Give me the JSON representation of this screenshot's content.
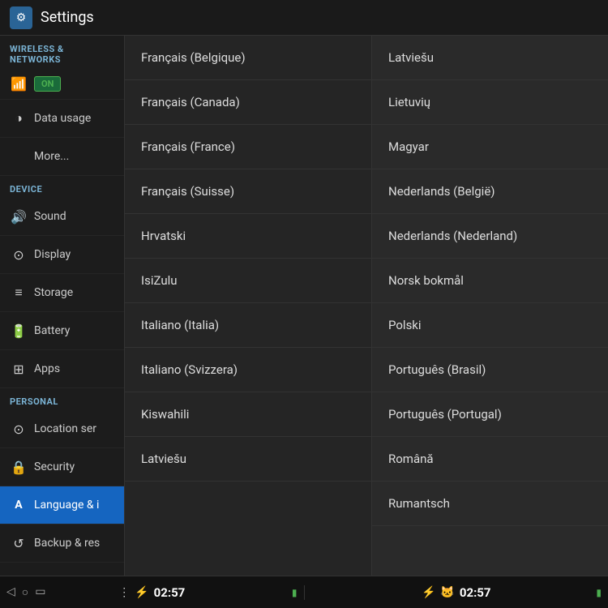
{
  "titleBar": {
    "icon": "⚙",
    "title": "Settings"
  },
  "sidebar": {
    "sections": [
      {
        "header": "WIRELESS & NETWORKS",
        "items": [
          {
            "id": "wifi",
            "icon": "📶",
            "label": "WiFi",
            "hasToggle": true,
            "toggleLabel": "ON"
          },
          {
            "id": "data-usage",
            "icon": "◑",
            "label": "Data usage",
            "hasToggle": false
          },
          {
            "id": "more",
            "icon": "",
            "label": "More...",
            "hasToggle": false
          }
        ]
      },
      {
        "header": "DEVICE",
        "items": [
          {
            "id": "sound",
            "icon": "🔊",
            "label": "Sound",
            "hasToggle": false
          },
          {
            "id": "display",
            "icon": "⊙",
            "label": "Display",
            "hasToggle": false
          },
          {
            "id": "storage",
            "icon": "≡",
            "label": "Storage",
            "hasToggle": false
          },
          {
            "id": "battery",
            "icon": "🔋",
            "label": "Battery",
            "hasToggle": false
          },
          {
            "id": "apps",
            "icon": "⊞",
            "label": "Apps",
            "hasToggle": false
          }
        ]
      },
      {
        "header": "PERSONAL",
        "items": [
          {
            "id": "location",
            "icon": "⊙",
            "label": "Location ser",
            "hasToggle": false
          },
          {
            "id": "security",
            "icon": "🔒",
            "label": "Security",
            "hasToggle": false
          },
          {
            "id": "language",
            "icon": "A",
            "label": "Language & i",
            "hasToggle": false,
            "active": true
          },
          {
            "id": "backup",
            "icon": "↺",
            "label": "Backup & res",
            "hasToggle": false
          }
        ]
      }
    ]
  },
  "middleList": {
    "items": [
      "Français (Belgique)",
      "Français (Canada)",
      "Français (France)",
      "Français (Suisse)",
      "Hrvatski",
      "IsiZulu",
      "Italiano (Italia)",
      "Italiano (Svizzera)",
      "Kiswahili",
      "Latviešu"
    ]
  },
  "rightList": {
    "items": [
      "Latviešu",
      "Lietuvių",
      "Magyar",
      "Nederlands (België)",
      "Nederlands (Nederland)",
      "Norsk bokmål",
      "Polski",
      "Português (Brasil)",
      "Português (Portugal)",
      "Română",
      "Rumantsch"
    ]
  },
  "statusBar": {
    "left": {
      "navIcons": [
        "◁",
        "○",
        "▭"
      ],
      "centerIcons": [
        "⋮",
        "⚡"
      ],
      "time": "02:57",
      "rightIcons": [
        "⚡"
      ]
    },
    "right": {
      "centerIcons": [
        "↕",
        "🐱"
      ],
      "time": "02:57",
      "rightIcons": [
        "⚡"
      ]
    }
  }
}
